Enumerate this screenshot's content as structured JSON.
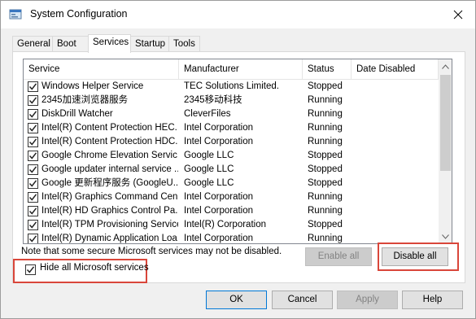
{
  "window": {
    "title": "System Configuration"
  },
  "tabs": [
    "General",
    "Boot",
    "Services",
    "Startup",
    "Tools"
  ],
  "active_tab": "Services",
  "columns": [
    "Service",
    "Manufacturer",
    "Status",
    "Date Disabled"
  ],
  "services": [
    {
      "name": "Windows Helper Service",
      "manufacturer": "TEC Solutions Limited.",
      "status": "Stopped",
      "date_disabled": ""
    },
    {
      "name": "2345加速浏览器服务",
      "manufacturer": "2345移动科技",
      "status": "Running",
      "date_disabled": ""
    },
    {
      "name": "DiskDrill Watcher",
      "manufacturer": "CleverFiles",
      "status": "Running",
      "date_disabled": ""
    },
    {
      "name": "Intel(R) Content Protection HEC...",
      "manufacturer": "Intel Corporation",
      "status": "Running",
      "date_disabled": ""
    },
    {
      "name": "Intel(R) Content Protection HDC...",
      "manufacturer": "Intel Corporation",
      "status": "Running",
      "date_disabled": ""
    },
    {
      "name": "Google Chrome Elevation Servic...",
      "manufacturer": "Google LLC",
      "status": "Stopped",
      "date_disabled": ""
    },
    {
      "name": "Google updater internal service ...",
      "manufacturer": "Google LLC",
      "status": "Stopped",
      "date_disabled": ""
    },
    {
      "name": "Google 更新程序服务 (GoogleU...",
      "manufacturer": "Google LLC",
      "status": "Stopped",
      "date_disabled": ""
    },
    {
      "name": "Intel(R) Graphics Command Cen...",
      "manufacturer": "Intel Corporation",
      "status": "Running",
      "date_disabled": ""
    },
    {
      "name": "Intel(R) HD Graphics Control Pa...",
      "manufacturer": "Intel Corporation",
      "status": "Running",
      "date_disabled": ""
    },
    {
      "name": "Intel(R) TPM Provisioning Service",
      "manufacturer": "Intel(R) Corporation",
      "status": "Stopped",
      "date_disabled": ""
    },
    {
      "name": "Intel(R) Dynamic Application Loa...",
      "manufacturer": "Intel Corporation",
      "status": "Running",
      "date_disabled": ""
    }
  ],
  "note": "Note that some secure Microsoft services may not be disabled.",
  "buttons": {
    "enable_all": "Enable all",
    "disable_all": "Disable all",
    "ok": "OK",
    "cancel": "Cancel",
    "apply": "Apply",
    "help": "Help"
  },
  "hide_ms": {
    "label": "Hide all Microsoft services",
    "checked": true
  },
  "colors": {
    "highlight": "#d9463a"
  }
}
